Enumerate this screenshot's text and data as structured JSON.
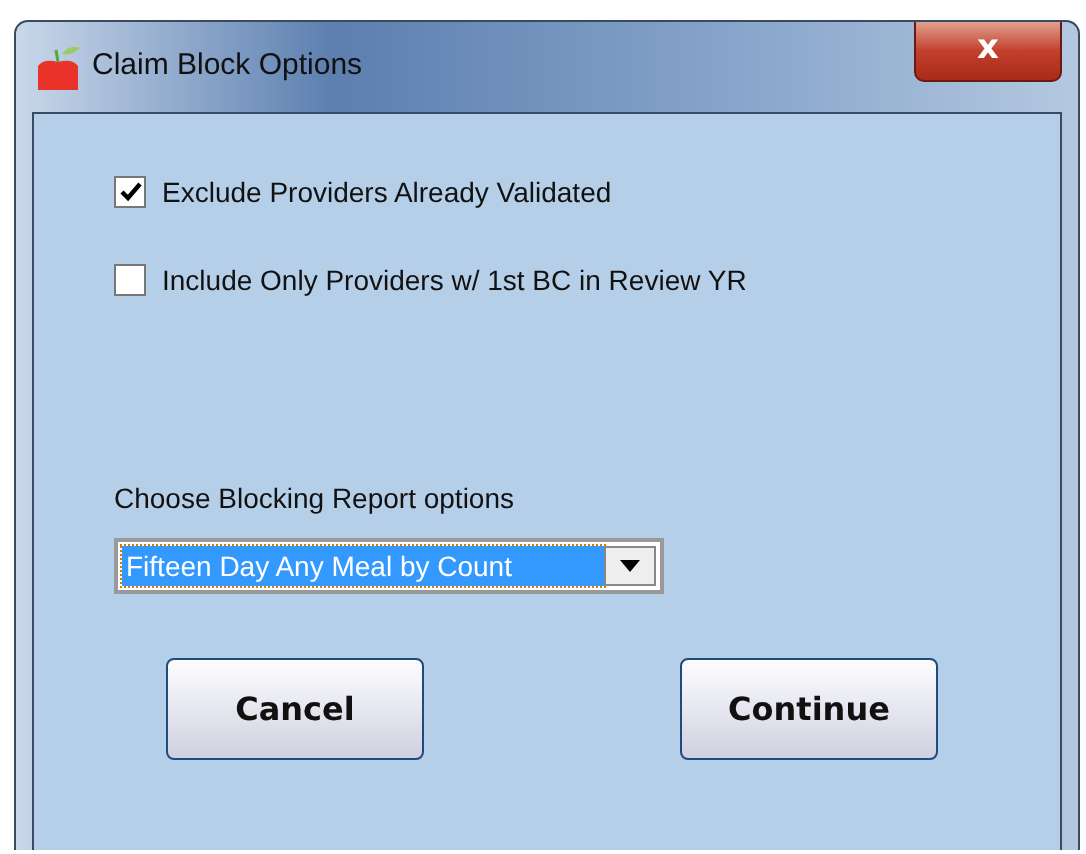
{
  "window": {
    "title": "Claim Block Options",
    "close": "x"
  },
  "options": [
    {
      "label": "Exclude Providers Already Validated",
      "checked": true
    },
    {
      "label": "Include Only Providers w/ 1st BC in Review YR",
      "checked": false
    }
  ],
  "report": {
    "label": "Choose Blocking Report options",
    "value": "Fifteen Day Any Meal by Count"
  },
  "buttons": [
    "Cancel",
    "Continue"
  ]
}
